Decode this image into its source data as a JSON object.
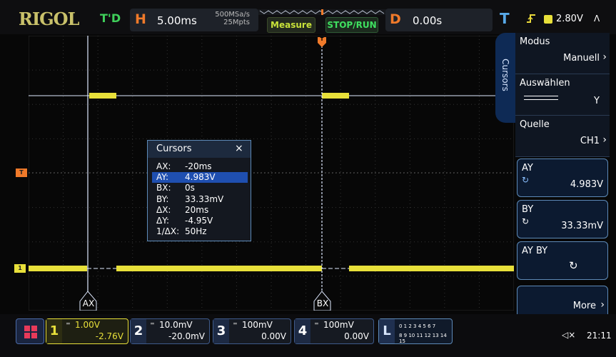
{
  "brand": "RIGOL",
  "top": {
    "trigger_status": "T'D",
    "h_label": "H",
    "timebase": "5.00ms",
    "sample_rate": "500MSa/s",
    "memory_depth": "25Mpts",
    "measure_label": "Measure",
    "stoprun_label": "STOP/RUN",
    "d_label": "D",
    "delay": "0.00s",
    "t_label": "T",
    "trigger_level": "2.80V",
    "trigger_edge": "rising-edge-icon",
    "up_arrow": "Λ"
  },
  "cursors_panel": {
    "title": "Cursors",
    "close": "×",
    "rows": [
      {
        "key": "AX:",
        "value": "-20ms"
      },
      {
        "key": "AY:",
        "value": "4.983V"
      },
      {
        "key": "BX:",
        "value": "0s"
      },
      {
        "key": "BY:",
        "value": "33.33mV"
      },
      {
        "key": "ΔX:",
        "value": "20ms"
      },
      {
        "key": "ΔY:",
        "value": "-4.95V"
      },
      {
        "key": "1/ΔX:",
        "value": "50Hz"
      }
    ],
    "selected_row": 1
  },
  "cursor_labels": {
    "ax": "AX",
    "bx": "BX"
  },
  "markers": {
    "trigger_level": "T",
    "ch1": "1",
    "top_t": "T"
  },
  "right_menu": {
    "tab": "Cursors",
    "mode_label": "Modus",
    "mode_value": "Manuell",
    "select_label": "Auswählen",
    "select_value": "Y",
    "source_label": "Quelle",
    "source_value": "CH1",
    "ay_label": "AY",
    "ay_value": "4.983V",
    "by_label": "BY",
    "by_value": "33.33mV",
    "ayby_label": "AY BY",
    "more_label": "More"
  },
  "channels": [
    {
      "num": "1",
      "scale": "1.00V",
      "offset": "-2.76V",
      "color": "#e8e03a"
    },
    {
      "num": "2",
      "scale": "10.0mV",
      "offset": "-20.0mV",
      "color": "#3da8f0"
    },
    {
      "num": "3",
      "scale": "100mV",
      "offset": "0.00V",
      "color": "#e04ad8"
    },
    {
      "num": "4",
      "scale": "100mV",
      "offset": "0.00V",
      "color": "#3d7ff0"
    }
  ],
  "logic": {
    "label": "L",
    "bits_row1": "0 1 2 3  4 5 6 7",
    "bits_row2": "8 9 10 11 12 13 14 15"
  },
  "clock": "21:11",
  "colors": {
    "ch1": "#e8e03a",
    "cursor": "#dfe9ff",
    "accent_orange": "#f07a2a",
    "panel_border": "#5d8ab8"
  }
}
